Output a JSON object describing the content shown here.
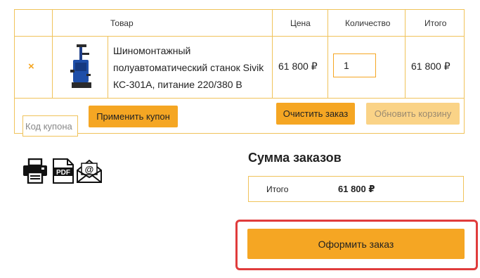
{
  "cart": {
    "headers": {
      "product": "Товар",
      "price": "Цена",
      "quantity": "Количество",
      "total": "Итого"
    },
    "item": {
      "remove_icon": "×",
      "name": "Шиномонтажный полуавтоматический станок Sivik КС-301А, питание 220/380 В",
      "price": "61 800 ₽",
      "quantity": "1",
      "subtotal": "61 800 ₽"
    },
    "actions": {
      "coupon_placeholder": "Код купона",
      "apply_coupon": "Применить купон",
      "clear_order": "Очистить заказ",
      "update_cart": "Обновить корзину"
    }
  },
  "share_icons": [
    "printer-icon",
    "pdf-icon",
    "email-icon"
  ],
  "totals": {
    "title": "Сумма заказов",
    "label": "Итого",
    "value": "61 800 ₽"
  },
  "checkout": {
    "label": "Оформить заказ"
  },
  "colors": {
    "accent": "#f5a623",
    "border": "#f0c35a",
    "highlight": "#e03c3c"
  }
}
